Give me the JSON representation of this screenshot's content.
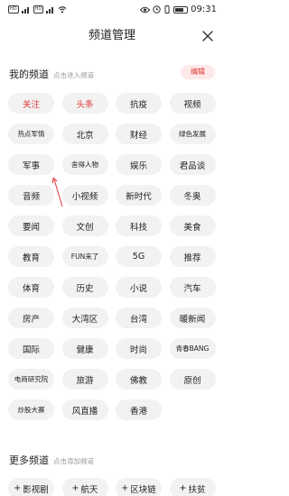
{
  "status_bar": {
    "left_badges": [
      "HD",
      "HD"
    ],
    "time": "09:31"
  },
  "header": {
    "title": "频道管理"
  },
  "my_channels": {
    "title": "我的频道",
    "hint": "点击进入频道",
    "edit_label": "编辑",
    "items": [
      {
        "label": "关注",
        "style": "red"
      },
      {
        "label": "头条",
        "style": "red"
      },
      {
        "label": "抗疫"
      },
      {
        "label": "视频"
      },
      {
        "label": "热点军情",
        "style": "small"
      },
      {
        "label": "北京"
      },
      {
        "label": "财经"
      },
      {
        "label": "绿色发展",
        "style": "small"
      },
      {
        "label": "军事"
      },
      {
        "label": "舍得人物",
        "style": "small"
      },
      {
        "label": "娱乐"
      },
      {
        "label": "君品谈"
      },
      {
        "label": "音频"
      },
      {
        "label": "小视频"
      },
      {
        "label": "新时代"
      },
      {
        "label": "冬奥"
      },
      {
        "label": "要闻"
      },
      {
        "label": "文创"
      },
      {
        "label": "科技"
      },
      {
        "label": "美食"
      },
      {
        "label": "教育"
      },
      {
        "label": "FUN来了",
        "style": "small"
      },
      {
        "label": "5G"
      },
      {
        "label": "推荐"
      },
      {
        "label": "体育"
      },
      {
        "label": "历史"
      },
      {
        "label": "小说"
      },
      {
        "label": "汽车"
      },
      {
        "label": "房产"
      },
      {
        "label": "大湾区"
      },
      {
        "label": "台湾"
      },
      {
        "label": "暖新闻"
      },
      {
        "label": "国际"
      },
      {
        "label": "健康"
      },
      {
        "label": "时尚"
      },
      {
        "label": "青春BANG",
        "style": "small"
      },
      {
        "label": "电商研究院",
        "style": "small"
      },
      {
        "label": "旅游"
      },
      {
        "label": "佛教"
      },
      {
        "label": "原创"
      },
      {
        "label": "炒股大赛",
        "style": "small"
      },
      {
        "label": "风直播"
      },
      {
        "label": "香港"
      }
    ]
  },
  "more_channels": {
    "title": "更多频道",
    "hint": "点击添加频道",
    "add_prefix": "+",
    "items": [
      {
        "label": "影视剧"
      },
      {
        "label": "航天"
      },
      {
        "label": "区块链"
      },
      {
        "label": "扶贫"
      }
    ]
  },
  "colors": {
    "accent": "#e13636",
    "chip_bg": "#f2f2f2",
    "edit_bg": "#fde9e9",
    "annotation_arrow": "#e13636"
  }
}
